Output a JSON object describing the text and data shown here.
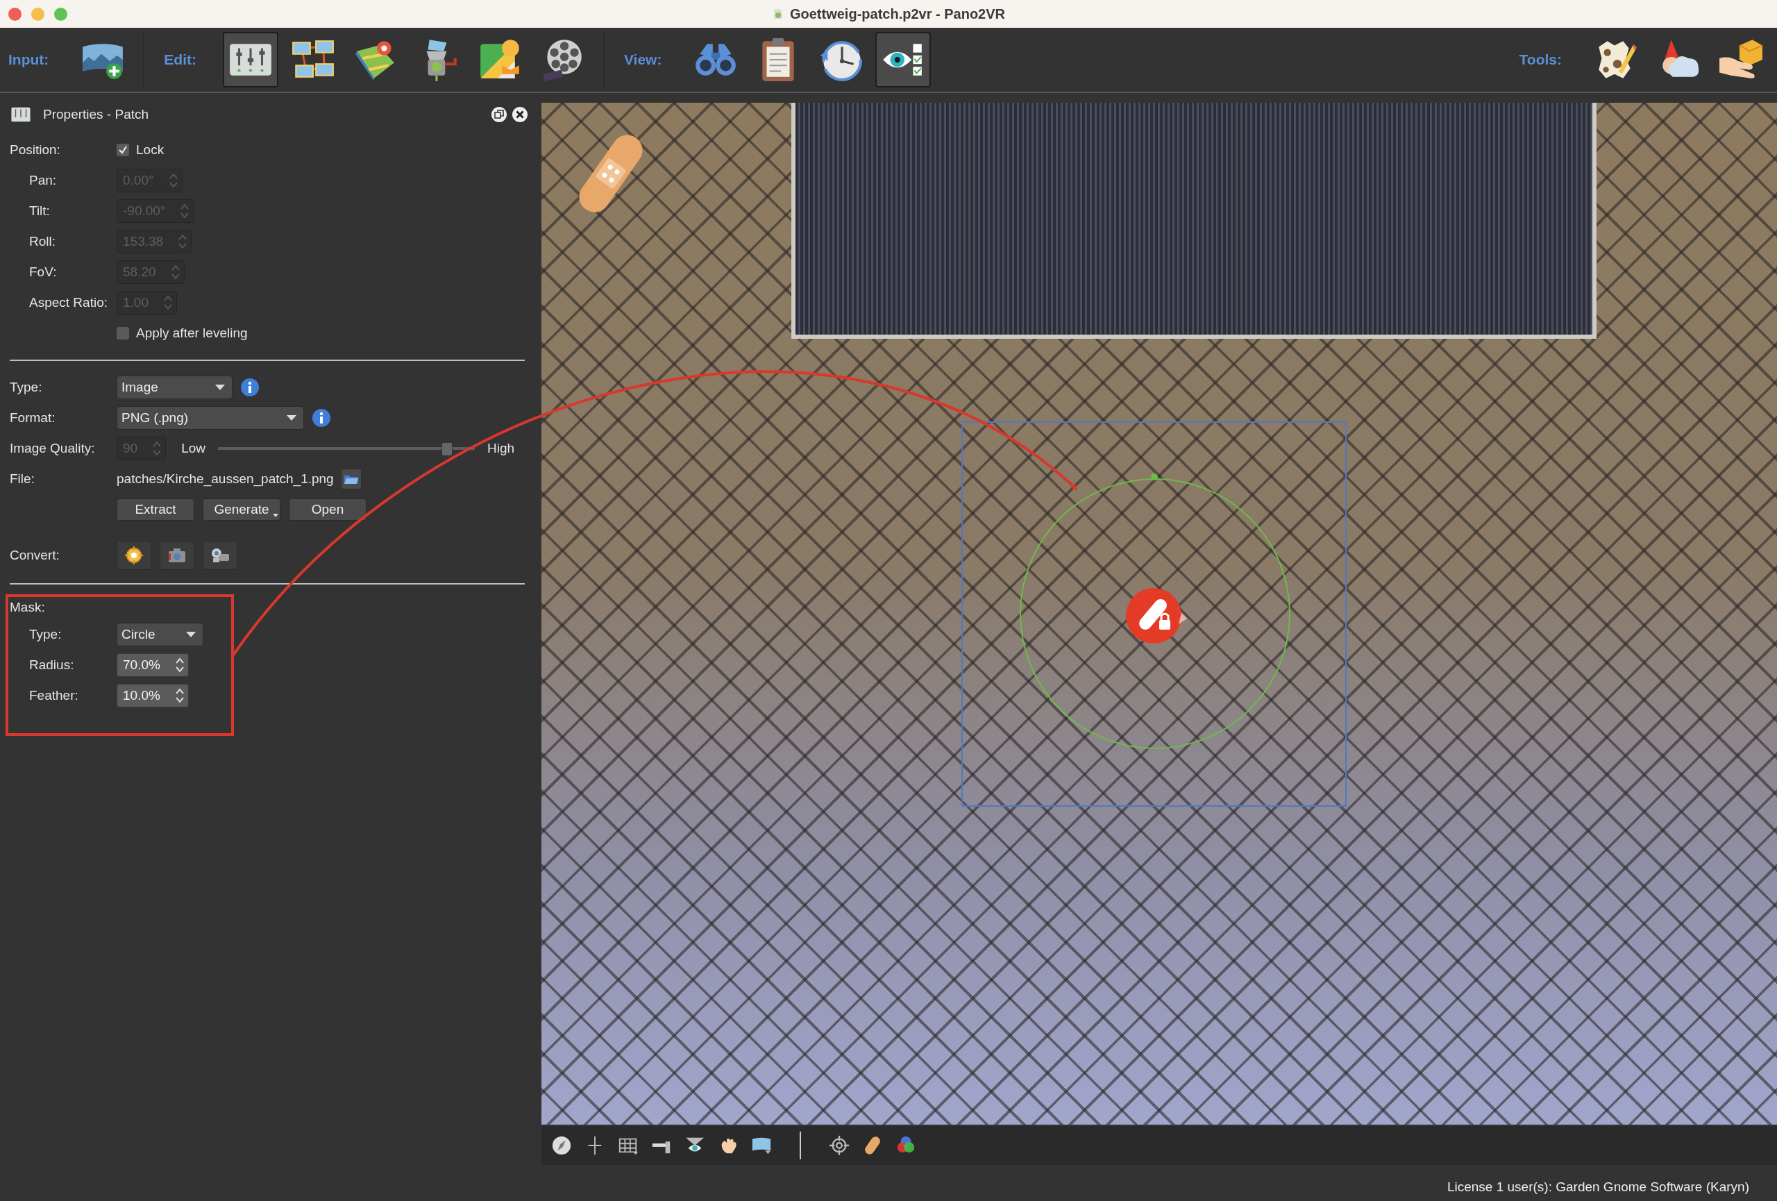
{
  "window": {
    "title": "Goettweig-patch.p2vr - Pano2VR"
  },
  "toolbar": {
    "groups": [
      {
        "label": "Input:",
        "buttons": [
          {
            "selected": false
          }
        ]
      },
      {
        "label": "Edit:",
        "buttons": [
          {
            "selected": true
          },
          {
            "selected": false
          },
          {
            "selected": false
          },
          {
            "selected": false
          },
          {
            "selected": false
          },
          {
            "selected": false
          }
        ]
      },
      {
        "label": "View:",
        "buttons": [
          {
            "selected": false
          },
          {
            "selected": false
          },
          {
            "selected": false
          },
          {
            "selected": true
          }
        ]
      },
      {
        "label": "Tools:",
        "buttons": [
          {
            "selected": false
          },
          {
            "selected": false
          },
          {
            "selected": false
          }
        ]
      }
    ]
  },
  "panel": {
    "title": "Properties - Patch",
    "position": {
      "label": "Position:",
      "lock": {
        "label": "Lock",
        "checked": true
      }
    },
    "position_fields": [
      {
        "label": "Pan:",
        "value": "0.00°",
        "disabled": true
      },
      {
        "label": "Tilt:",
        "value": "-90.00°",
        "disabled": true
      },
      {
        "label": "Roll:",
        "value": "153.38",
        "disabled": true
      },
      {
        "label": "FoV:",
        "value": "58.20",
        "disabled": true
      },
      {
        "label": "Aspect Ratio:",
        "value": "1.00",
        "disabled": true
      }
    ],
    "apply_after_leveling": {
      "label": "Apply after leveling",
      "checked": false
    },
    "type": {
      "label": "Type:",
      "value": "Image"
    },
    "format": {
      "label": "Format:",
      "value": "PNG (.png)"
    },
    "image_quality": {
      "label": "Image Quality:",
      "value": "90",
      "disabled": true,
      "low": "Low",
      "high": "High",
      "level": 0.89
    },
    "file": {
      "label": "File:",
      "value": "patches/Kirche_aussen_patch_1.png"
    },
    "file_buttons": [
      {
        "label": "Extract",
        "kind": "plain"
      },
      {
        "label": "Generate",
        "kind": "menu"
      },
      {
        "label": "Open",
        "kind": "plain"
      }
    ],
    "convert": {
      "label": "Convert:"
    },
    "mask": {
      "label": "Mask:",
      "type": {
        "label": "Type:",
        "value": "Circle"
      },
      "fields": [
        {
          "label": "Radius:",
          "value": "70.0%",
          "disabled": false
        },
        {
          "label": "Feather:",
          "value": "10.0%",
          "disabled": false
        }
      ]
    }
  },
  "status_bar": {
    "text": "License 1 user(s): Garden Gnome Software (Karyn)"
  }
}
